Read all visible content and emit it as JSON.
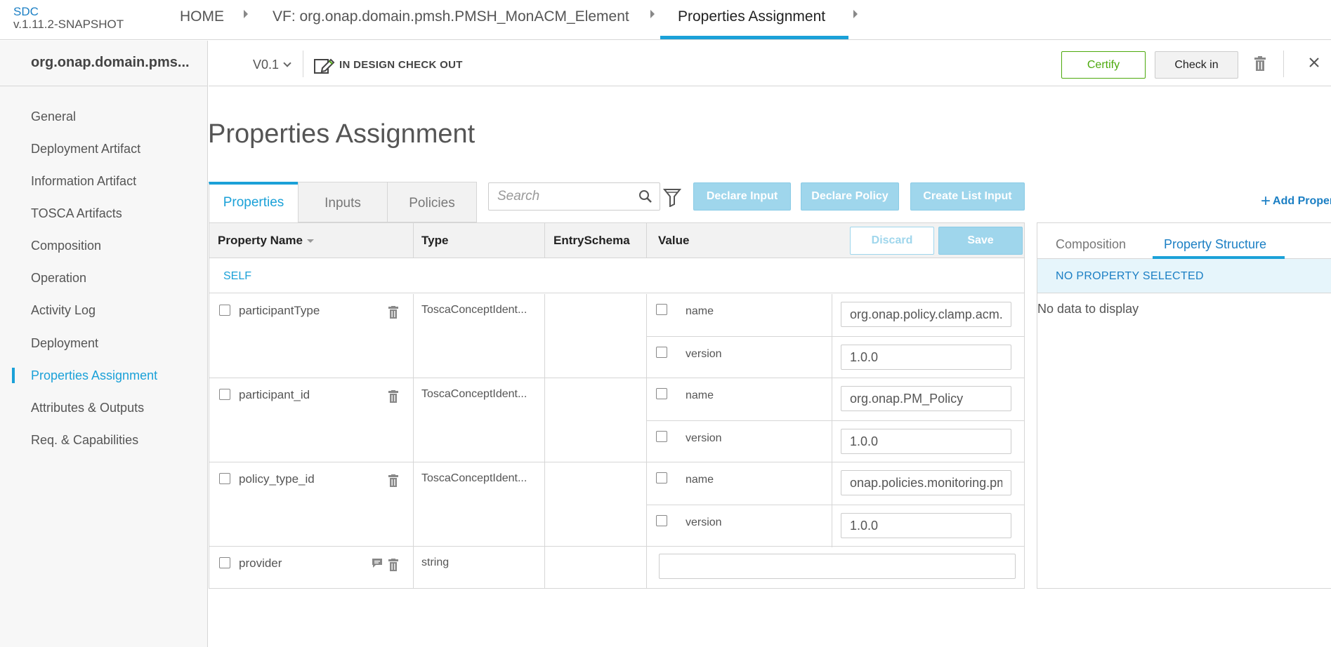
{
  "app": {
    "brand": "SDC",
    "version": "v.1.11.2-SNAPSHOT"
  },
  "breadcrumb": {
    "home": "HOME",
    "vf": "VF: org.onap.domain.pmsh.PMSH_MonACM_Element",
    "current": "Properties Assignment"
  },
  "sidebar": {
    "title": "org.onap.domain.pms...",
    "items": [
      {
        "label": "General"
      },
      {
        "label": "Deployment Artifact"
      },
      {
        "label": "Information Artifact"
      },
      {
        "label": "TOSCA Artifacts"
      },
      {
        "label": "Composition"
      },
      {
        "label": "Operation"
      },
      {
        "label": "Activity Log"
      },
      {
        "label": "Deployment"
      },
      {
        "label": "Properties Assignment"
      },
      {
        "label": "Attributes & Outputs"
      },
      {
        "label": "Req. & Capabilities"
      }
    ],
    "active_index": 8
  },
  "subheader": {
    "version": "V0.1",
    "status": "IN DESIGN CHECK OUT",
    "certify_label": "Certify",
    "checkin_label": "Check in"
  },
  "page": {
    "title": "Properties Assignment"
  },
  "tabs": [
    {
      "label": "Properties"
    },
    {
      "label": "Inputs"
    },
    {
      "label": "Policies"
    }
  ],
  "search": {
    "placeholder": "Search",
    "value": ""
  },
  "actions": {
    "declare_input": "Declare Input",
    "declare_policy": "Declare Policy",
    "create_list_input": "Create List Input",
    "add_property": "Add Proper"
  },
  "table": {
    "headers": {
      "name": "Property Name",
      "type": "Type",
      "entry_schema": "EntrySchema",
      "value": "Value"
    },
    "discard_label": "Discard",
    "save_label": "Save",
    "group_label": "SELF",
    "rows": [
      {
        "name": "participantType",
        "type": "ToscaConceptIdent...",
        "subs": [
          {
            "label": "name",
            "value": "org.onap.policy.clamp.acm.Policy"
          },
          {
            "label": "version",
            "value": "1.0.0"
          }
        ]
      },
      {
        "name": "participant_id",
        "type": "ToscaConceptIdent...",
        "subs": [
          {
            "label": "name",
            "value": "org.onap.PM_Policy"
          },
          {
            "label": "version",
            "value": "1.0.0"
          }
        ]
      },
      {
        "name": "policy_type_id",
        "type": "ToscaConceptIdent...",
        "subs": [
          {
            "label": "name",
            "value": "onap.policies.monitoring.pm-subscription-handler"
          },
          {
            "label": "version",
            "value": "1.0.0"
          }
        ]
      },
      {
        "name": "provider",
        "type": "string",
        "value": ""
      }
    ]
  },
  "right_panel": {
    "tab_composition": "Composition",
    "tab_structure": "Property Structure",
    "band": "NO PROPERTY SELECTED",
    "empty": "No data to display"
  },
  "colors": {
    "accent": "#1ba1d8",
    "certify": "#4ca90c",
    "disabled_button": "#9fd6ec"
  }
}
